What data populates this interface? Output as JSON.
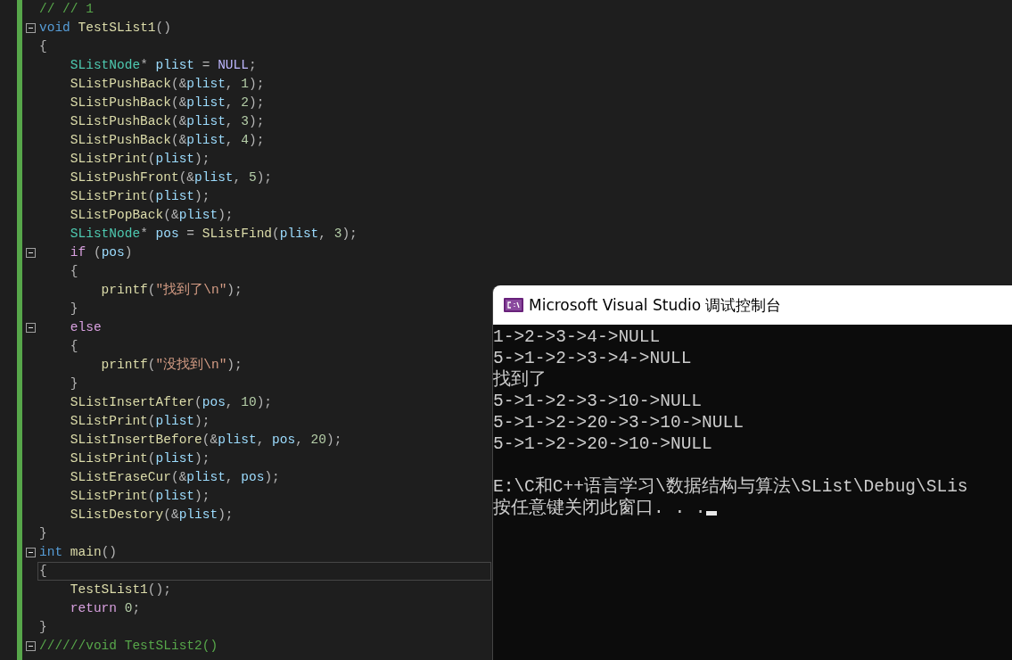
{
  "editor": {
    "lines": [
      {
        "fold": false,
        "current": false,
        "tokens": [
          {
            "kind": "comment",
            "text": "// // 1"
          }
        ]
      },
      {
        "fold": true,
        "current": false,
        "tokens": [
          {
            "kind": "kw",
            "text": "void"
          },
          {
            "kind": "fn",
            "text": " TestSList1"
          },
          {
            "kind": "p",
            "text": "()"
          }
        ]
      },
      {
        "fold": false,
        "current": false,
        "tokens": [
          {
            "kind": "p",
            "text": "{"
          }
        ]
      },
      {
        "fold": false,
        "current": false,
        "tokens": [
          {
            "kind": "type",
            "text": "    SListNode"
          },
          {
            "kind": "p",
            "text": "* "
          },
          {
            "kind": "var",
            "text": "plist"
          },
          {
            "kind": "p",
            "text": " = "
          },
          {
            "kind": "macro",
            "text": "NULL"
          },
          {
            "kind": "p",
            "text": ";"
          }
        ]
      },
      {
        "fold": false,
        "current": false,
        "tokens": [
          {
            "kind": "fn",
            "text": "    SListPushBack"
          },
          {
            "kind": "p",
            "text": "(&"
          },
          {
            "kind": "var",
            "text": "plist"
          },
          {
            "kind": "p",
            "text": ","
          },
          {
            "kind": "num",
            "text": " 1"
          },
          {
            "kind": "p",
            "text": ");"
          }
        ]
      },
      {
        "fold": false,
        "current": false,
        "tokens": [
          {
            "kind": "fn",
            "text": "    SListPushBack"
          },
          {
            "kind": "p",
            "text": "(&"
          },
          {
            "kind": "var",
            "text": "plist"
          },
          {
            "kind": "p",
            "text": ","
          },
          {
            "kind": "num",
            "text": " 2"
          },
          {
            "kind": "p",
            "text": ");"
          }
        ]
      },
      {
        "fold": false,
        "current": false,
        "tokens": [
          {
            "kind": "fn",
            "text": "    SListPushBack"
          },
          {
            "kind": "p",
            "text": "(&"
          },
          {
            "kind": "var",
            "text": "plist"
          },
          {
            "kind": "p",
            "text": ","
          },
          {
            "kind": "num",
            "text": " 3"
          },
          {
            "kind": "p",
            "text": ");"
          }
        ]
      },
      {
        "fold": false,
        "current": false,
        "tokens": [
          {
            "kind": "fn",
            "text": "    SListPushBack"
          },
          {
            "kind": "p",
            "text": "(&"
          },
          {
            "kind": "var",
            "text": "plist"
          },
          {
            "kind": "p",
            "text": ","
          },
          {
            "kind": "num",
            "text": " 4"
          },
          {
            "kind": "p",
            "text": ");"
          }
        ]
      },
      {
        "fold": false,
        "current": false,
        "tokens": [
          {
            "kind": "fn",
            "text": "    SListPrint"
          },
          {
            "kind": "p",
            "text": "("
          },
          {
            "kind": "var",
            "text": "plist"
          },
          {
            "kind": "p",
            "text": ");"
          }
        ]
      },
      {
        "fold": false,
        "current": false,
        "tokens": [
          {
            "kind": "fn",
            "text": "    SListPushFront"
          },
          {
            "kind": "p",
            "text": "(&"
          },
          {
            "kind": "var",
            "text": "plist"
          },
          {
            "kind": "p",
            "text": ","
          },
          {
            "kind": "num",
            "text": " 5"
          },
          {
            "kind": "p",
            "text": ");"
          }
        ]
      },
      {
        "fold": false,
        "current": false,
        "tokens": [
          {
            "kind": "fn",
            "text": "    SListPrint"
          },
          {
            "kind": "p",
            "text": "("
          },
          {
            "kind": "var",
            "text": "plist"
          },
          {
            "kind": "p",
            "text": ");"
          }
        ]
      },
      {
        "fold": false,
        "current": false,
        "tokens": [
          {
            "kind": "fn",
            "text": "    SListPopBack"
          },
          {
            "kind": "p",
            "text": "(&"
          },
          {
            "kind": "var",
            "text": "plist"
          },
          {
            "kind": "p",
            "text": ");"
          }
        ]
      },
      {
        "fold": false,
        "current": false,
        "tokens": [
          {
            "kind": "type",
            "text": "    SListNode"
          },
          {
            "kind": "p",
            "text": "* "
          },
          {
            "kind": "var",
            "text": "pos"
          },
          {
            "kind": "p",
            "text": " = "
          },
          {
            "kind": "fn",
            "text": "SListFind"
          },
          {
            "kind": "p",
            "text": "("
          },
          {
            "kind": "var",
            "text": "plist"
          },
          {
            "kind": "p",
            "text": ","
          },
          {
            "kind": "num",
            "text": " 3"
          },
          {
            "kind": "p",
            "text": ");"
          }
        ]
      },
      {
        "fold": true,
        "current": false,
        "tokens": [
          {
            "kind": "ctl",
            "text": "    if"
          },
          {
            "kind": "p",
            "text": " ("
          },
          {
            "kind": "var",
            "text": "pos"
          },
          {
            "kind": "p",
            "text": ")"
          }
        ]
      },
      {
        "fold": false,
        "current": false,
        "tokens": [
          {
            "kind": "p",
            "text": "    {"
          }
        ]
      },
      {
        "fold": false,
        "current": false,
        "tokens": [
          {
            "kind": "fn",
            "text": "        printf"
          },
          {
            "kind": "p",
            "text": "("
          },
          {
            "kind": "str",
            "text": "\"找到了\\n\""
          },
          {
            "kind": "p",
            "text": ");"
          }
        ]
      },
      {
        "fold": false,
        "current": false,
        "tokens": [
          {
            "kind": "p",
            "text": "    }"
          }
        ]
      },
      {
        "fold": true,
        "current": false,
        "tokens": [
          {
            "kind": "ctl",
            "text": "    else"
          }
        ]
      },
      {
        "fold": false,
        "current": false,
        "tokens": [
          {
            "kind": "p",
            "text": "    {"
          }
        ]
      },
      {
        "fold": false,
        "current": false,
        "tokens": [
          {
            "kind": "fn",
            "text": "        printf"
          },
          {
            "kind": "p",
            "text": "("
          },
          {
            "kind": "str",
            "text": "\"没找到\\n\""
          },
          {
            "kind": "p",
            "text": ");"
          }
        ]
      },
      {
        "fold": false,
        "current": false,
        "tokens": [
          {
            "kind": "p",
            "text": "    }"
          }
        ]
      },
      {
        "fold": false,
        "current": false,
        "tokens": [
          {
            "kind": "fn",
            "text": "    SListInsertAfter"
          },
          {
            "kind": "p",
            "text": "("
          },
          {
            "kind": "var",
            "text": "pos"
          },
          {
            "kind": "p",
            "text": ","
          },
          {
            "kind": "num",
            "text": " 10"
          },
          {
            "kind": "p",
            "text": ");"
          }
        ]
      },
      {
        "fold": false,
        "current": false,
        "tokens": [
          {
            "kind": "fn",
            "text": "    SListPrint"
          },
          {
            "kind": "p",
            "text": "("
          },
          {
            "kind": "var",
            "text": "plist"
          },
          {
            "kind": "p",
            "text": ");"
          }
        ]
      },
      {
        "fold": false,
        "current": false,
        "tokens": [
          {
            "kind": "fn",
            "text": "    SListInsertBefore"
          },
          {
            "kind": "p",
            "text": "(&"
          },
          {
            "kind": "var",
            "text": "plist"
          },
          {
            "kind": "p",
            "text": ","
          },
          {
            "kind": "var",
            "text": " pos"
          },
          {
            "kind": "p",
            "text": ","
          },
          {
            "kind": "num",
            "text": " 20"
          },
          {
            "kind": "p",
            "text": ");"
          }
        ]
      },
      {
        "fold": false,
        "current": false,
        "tokens": [
          {
            "kind": "fn",
            "text": "    SListPrint"
          },
          {
            "kind": "p",
            "text": "("
          },
          {
            "kind": "var",
            "text": "plist"
          },
          {
            "kind": "p",
            "text": ");"
          }
        ]
      },
      {
        "fold": false,
        "current": false,
        "tokens": [
          {
            "kind": "fn",
            "text": "    SListEraseCur"
          },
          {
            "kind": "p",
            "text": "(&"
          },
          {
            "kind": "var",
            "text": "plist"
          },
          {
            "kind": "p",
            "text": ","
          },
          {
            "kind": "var",
            "text": " pos"
          },
          {
            "kind": "p",
            "text": ");"
          }
        ]
      },
      {
        "fold": false,
        "current": false,
        "tokens": [
          {
            "kind": "fn",
            "text": "    SListPrint"
          },
          {
            "kind": "p",
            "text": "("
          },
          {
            "kind": "var",
            "text": "plist"
          },
          {
            "kind": "p",
            "text": ");"
          }
        ]
      },
      {
        "fold": false,
        "current": false,
        "tokens": [
          {
            "kind": "fn",
            "text": "    SListDestory"
          },
          {
            "kind": "p",
            "text": "(&"
          },
          {
            "kind": "var",
            "text": "plist"
          },
          {
            "kind": "p",
            "text": ");"
          }
        ]
      },
      {
        "fold": false,
        "current": false,
        "tokens": [
          {
            "kind": "p",
            "text": "}"
          }
        ]
      },
      {
        "fold": true,
        "current": false,
        "tokens": [
          {
            "kind": "kw",
            "text": "int"
          },
          {
            "kind": "fn",
            "text": " main"
          },
          {
            "kind": "p",
            "text": "()"
          }
        ]
      },
      {
        "fold": false,
        "current": true,
        "tokens": [
          {
            "kind": "p",
            "text": "{"
          }
        ]
      },
      {
        "fold": false,
        "current": false,
        "tokens": [
          {
            "kind": "fn",
            "text": "    TestSList1"
          },
          {
            "kind": "p",
            "text": "();"
          }
        ]
      },
      {
        "fold": false,
        "current": false,
        "tokens": [
          {
            "kind": "ctl",
            "text": "    return"
          },
          {
            "kind": "num",
            "text": " 0"
          },
          {
            "kind": "p",
            "text": ";"
          }
        ]
      },
      {
        "fold": false,
        "current": false,
        "tokens": [
          {
            "kind": "p",
            "text": "}"
          }
        ]
      },
      {
        "fold": true,
        "current": false,
        "tokens": [
          {
            "kind": "comment",
            "text": "//////void TestSList2()"
          }
        ]
      }
    ]
  },
  "console": {
    "title": "Microsoft Visual Studio 调试控制台",
    "output": [
      "1->2->3->4->NULL",
      "5->1->2->3->4->NULL",
      "找到了",
      "5->1->2->3->10->NULL",
      "5->1->2->20->3->10->NULL",
      "5->1->2->20->10->NULL"
    ],
    "prompt": [
      "E:\\C和C++语言学习\\数据结构与算法\\SList\\Debug\\SLis",
      "按任意键关闭此窗口. . ."
    ]
  }
}
